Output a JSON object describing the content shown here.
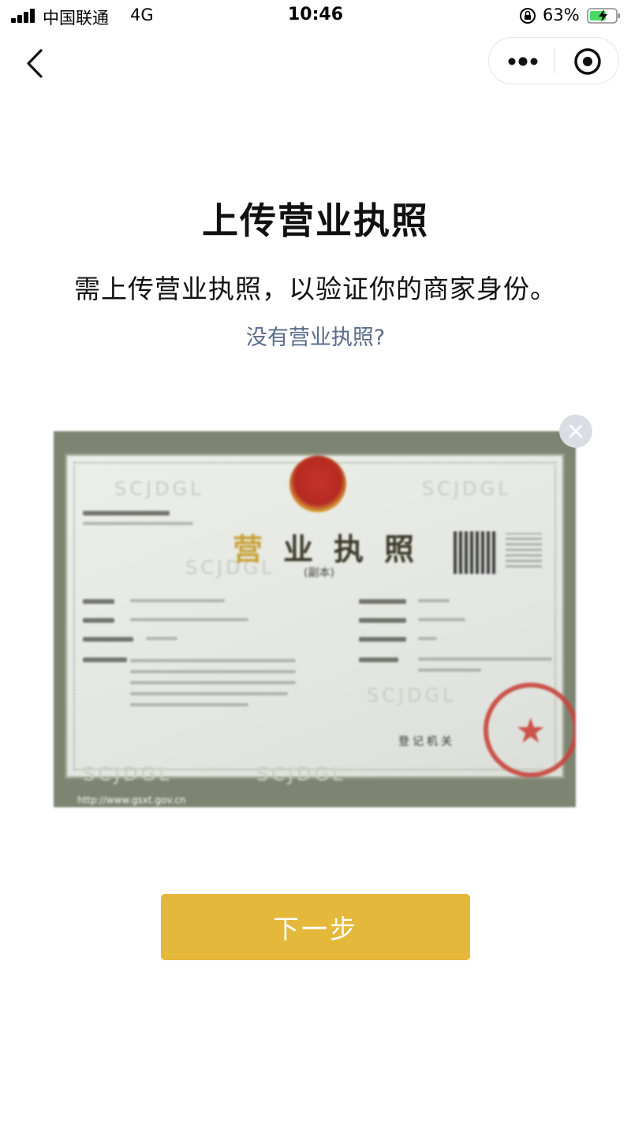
{
  "status_bar": {
    "carrier": "中国联通",
    "network": "4G",
    "time": "10:46",
    "battery": "63%"
  },
  "nav": {
    "back_icon": "chevron-left-icon",
    "more_icon": "more-dots-icon",
    "close_icon": "target-circle-icon"
  },
  "main": {
    "title": "上传营业执照",
    "description": "需上传营业执照，以验证你的商家身份。",
    "no_license_link": "没有营业执照?"
  },
  "license_image": {
    "cert_title_first": "营",
    "cert_title_rest": "业执照",
    "cert_subtitle": "(副本)",
    "registration_label": "登记机关",
    "watermark": "SCJDGL",
    "url": "http://www.gsxt.gov.cn",
    "remove_icon": "close-icon"
  },
  "next_button": {
    "label": "下一步"
  },
  "colors": {
    "accent": "#e4b83b",
    "link": "#5a6b8c",
    "text": "#111111",
    "seal_red": "#c8443b"
  }
}
